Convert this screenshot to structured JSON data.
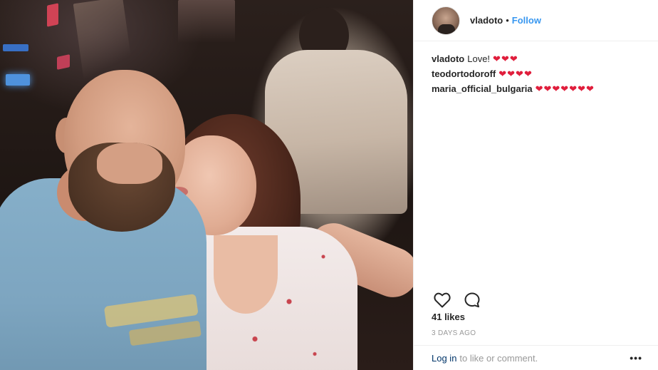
{
  "post": {
    "username": "vladoto",
    "separator": "•",
    "follow_label": "Follow"
  },
  "comments": [
    {
      "user": "vladoto",
      "text": "Love!",
      "hearts": "❤❤❤"
    },
    {
      "user": "teodortodoroff",
      "text": "",
      "hearts": "❤❤❤❤"
    },
    {
      "user": "maria_official_bulgaria",
      "text": "",
      "hearts": "❤❤❤❤❤❤❤"
    }
  ],
  "actions": {
    "like_icon": "heart-outline-icon",
    "comment_icon": "comment-bubble-icon"
  },
  "likes_text": "41 likes",
  "timestamp": "3 DAYS AGO",
  "footer": {
    "login_label": "Log in",
    "login_suffix": "to like or comment.",
    "more_label": "•••"
  },
  "colors": {
    "link_blue": "#3897f0",
    "login_navy": "#003569",
    "heart_red": "#e01e3c",
    "muted_gray": "#999999"
  }
}
